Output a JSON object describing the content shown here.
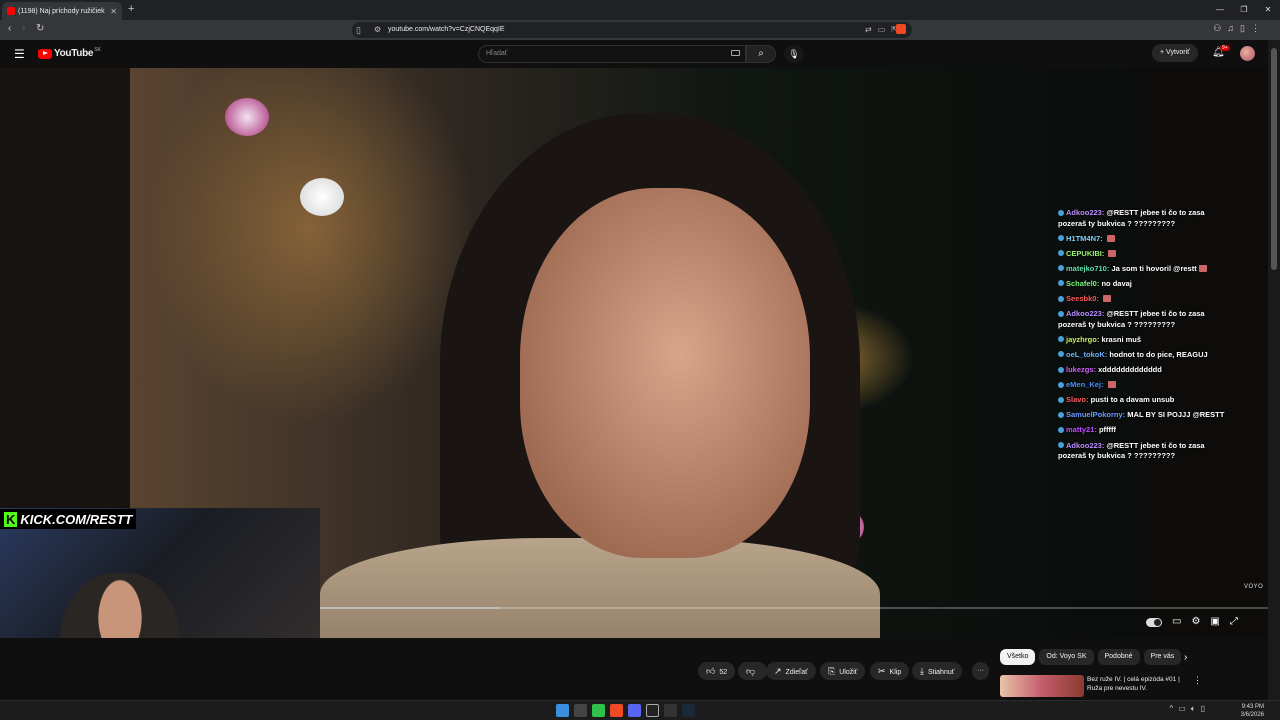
{
  "browser": {
    "tab_title": "(1198) Naj príchody ružičiek",
    "url": "youtube.com/watch?v=CzjCNQEqqIE"
  },
  "youtube": {
    "logo_text": "YouTube",
    "region": "SK",
    "search_placeholder": "Hľadať",
    "create_label": "Vytvoriť",
    "notifications_badge": "9+"
  },
  "overlay": {
    "kick_text": "KICK.COM/RESTT",
    "watermark": "VOYO",
    "progress_fraction": 0.19
  },
  "chat": [
    {
      "user": "Adkoo223:",
      "color": "#b98cff",
      "text": "@RESTT jebee ti čo to zasa pozeraš ty bukvica ? ?????????",
      "emote": false
    },
    {
      "user": "H1TM4N7:",
      "color": "#7fd4ff",
      "text": "",
      "emote": true
    },
    {
      "user": "CEPUKIBI:",
      "color": "#9bf56f",
      "text": "",
      "emote": true
    },
    {
      "user": "matejko710:",
      "color": "#5ee0b0",
      "text": "Ja som ti hovoril @restt",
      "emote": true
    },
    {
      "user": "Schafel0:",
      "color": "#7ef27e",
      "text": "no davaj",
      "emote": false
    },
    {
      "user": "Seesbk0:",
      "color": "#ff5a5a",
      "text": "",
      "emote": true
    },
    {
      "user": "Adkoo223:",
      "color": "#b98cff",
      "text": "@RESTT jebee ti čo to zasa pozeraš ty bukvica ? ?????????",
      "emote": false
    },
    {
      "user": "jayzhrgo:",
      "color": "#c9f26b",
      "text": "krasni muš",
      "emote": false
    },
    {
      "user": "oeL_tokoK:",
      "color": "#6fb3ff",
      "text": "hodnot to do pice, REAGUJ",
      "emote": false
    },
    {
      "user": "lukezgs:",
      "color": "#d060ff",
      "text": "xddddddddddddd",
      "emote": false
    },
    {
      "user": "eMen_Kej:",
      "color": "#4a90ff",
      "text": "",
      "emote": true
    },
    {
      "user": "Slavo:",
      "color": "#ff5a5a",
      "text": "pusti to a davam unsub",
      "emote": false
    },
    {
      "user": "SamuelPokorny:",
      "color": "#6f9bff",
      "text": "MAL BY SI POJJJ @RESTT",
      "emote": false
    },
    {
      "user": "matty21:",
      "color": "#c04cff",
      "text": "pfffff",
      "emote": false
    },
    {
      "user": "Adkoo223:",
      "color": "#b98cff",
      "text": "@RESTT jebee ti čo to zasa pozeraš ty bukvica ? ?????????",
      "emote": false
    }
  ],
  "actions": {
    "likes": "52",
    "share": "Zdieľať",
    "save": "Uložiť",
    "clip": "Klip",
    "download": "Stiahnuť"
  },
  "chips": [
    "Všetko",
    "Od: Voyo SK",
    "Podobné",
    "Pre vás"
  ],
  "recommendation": {
    "title": "Bez ruže IV. | celá epizóda #01 | Ruža pre nevestu IV."
  },
  "taskbar": {
    "time": "9:43 PM",
    "date": "3/6/2026"
  }
}
